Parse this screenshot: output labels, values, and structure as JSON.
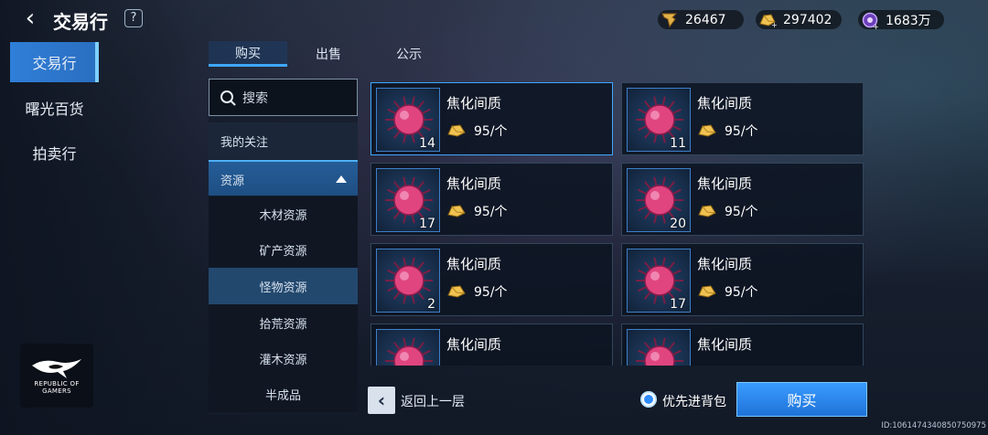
{
  "header": {
    "title": "交易行",
    "help": "?"
  },
  "currencies": [
    {
      "icon": "wing-token-icon",
      "value": "26467"
    },
    {
      "icon": "gold-ingot-icon",
      "value": "297402"
    },
    {
      "icon": "energy-orb-icon",
      "value": "1683万"
    }
  ],
  "nav": [
    {
      "label": "交易行",
      "active": true
    },
    {
      "label": "曙光百货"
    },
    {
      "label": "拍卖行"
    }
  ],
  "logo": {
    "line1": "REPUBLIC OF",
    "line2": "GAMERS"
  },
  "tabs": [
    {
      "label": "购买",
      "active": true
    },
    {
      "label": "出售"
    },
    {
      "label": "公示"
    }
  ],
  "search": {
    "placeholder": "搜索"
  },
  "categories": {
    "favorites": "我的关注",
    "resources": "资源",
    "sub": [
      "木材资源",
      "矿产资源",
      "怪物资源",
      "拾荒资源",
      "灌木资源",
      "半成品"
    ],
    "selected_index": 2
  },
  "items": [
    {
      "name": "焦化间质",
      "price": "95/个",
      "qty": "14",
      "selected": true
    },
    {
      "name": "焦化间质",
      "price": "95/个",
      "qty": "11"
    },
    {
      "name": "焦化间质",
      "price": "95/个",
      "qty": "17"
    },
    {
      "name": "焦化间质",
      "price": "95/个",
      "qty": "20"
    },
    {
      "name": "焦化间质",
      "price": "95/个",
      "qty": "2"
    },
    {
      "name": "焦化间质",
      "price": "95/个",
      "qty": "17"
    },
    {
      "name": "焦化间质"
    },
    {
      "name": "焦化间质"
    }
  ],
  "footer": {
    "back_label": "返回上一层",
    "priority_label": "优先进背包",
    "priority_checked": true,
    "buy_label": "购买"
  },
  "uid": "ID:1061474340850750975",
  "colors": {
    "accent": "#3fa7ff",
    "buy": "#2f86ec",
    "item": "#e0457f"
  }
}
